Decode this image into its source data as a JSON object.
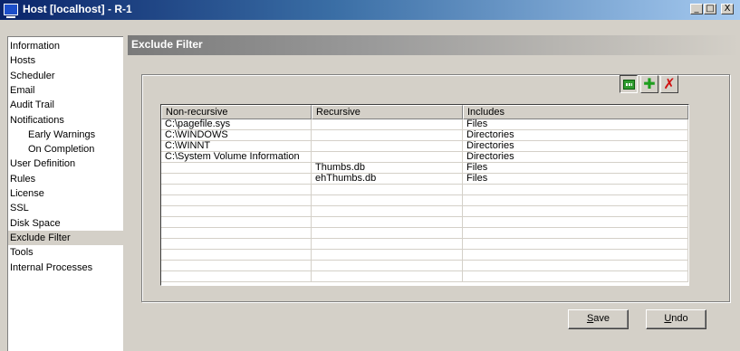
{
  "window": {
    "title": "Host [localhost] - R-1",
    "min_glyph": "_",
    "max_glyph": "□",
    "close_glyph": "X"
  },
  "sidebar": {
    "items": [
      {
        "label": "Information",
        "indent": false,
        "selected": false
      },
      {
        "label": "Hosts",
        "indent": false,
        "selected": false
      },
      {
        "label": "Scheduler",
        "indent": false,
        "selected": false
      },
      {
        "label": "Email",
        "indent": false,
        "selected": false
      },
      {
        "label": "Audit Trail",
        "indent": false,
        "selected": false
      },
      {
        "label": "Notifications",
        "indent": false,
        "selected": false
      },
      {
        "label": "Early Warnings",
        "indent": true,
        "selected": false
      },
      {
        "label": "On Completion",
        "indent": true,
        "selected": false
      },
      {
        "label": "User Definition",
        "indent": false,
        "selected": false
      },
      {
        "label": "Rules",
        "indent": false,
        "selected": false
      },
      {
        "label": "License",
        "indent": false,
        "selected": false
      },
      {
        "label": "SSL",
        "indent": false,
        "selected": false
      },
      {
        "label": "Disk Space",
        "indent": false,
        "selected": false
      },
      {
        "label": "Exclude Filter",
        "indent": false,
        "selected": true
      },
      {
        "label": "Tools",
        "indent": false,
        "selected": false
      },
      {
        "label": "Internal Processes",
        "indent": false,
        "selected": false
      }
    ]
  },
  "header": {
    "title": "Exclude Filter"
  },
  "toolbar": {
    "edit_icon": "edit-icon",
    "add_icon": "add-icon",
    "delete_icon": "delete-icon",
    "add_glyph": "✚",
    "delete_glyph": "✗"
  },
  "table": {
    "columns": [
      "Non-recursive",
      "Recursive",
      "Includes"
    ],
    "rows": [
      [
        "C:\\pagefile.sys",
        "",
        "Files"
      ],
      [
        "C:\\WINDOWS",
        "",
        "Directories"
      ],
      [
        "C:\\WINNT",
        "",
        "Directories"
      ],
      [
        "C:\\System Volume Information",
        "",
        "Directories"
      ],
      [
        "",
        "Thumbs.db",
        "Files"
      ],
      [
        "",
        "ehThumbs.db",
        "Files"
      ],
      [
        "",
        "",
        ""
      ],
      [
        "",
        "",
        ""
      ],
      [
        "",
        "",
        ""
      ],
      [
        "",
        "",
        ""
      ],
      [
        "",
        "",
        ""
      ],
      [
        "",
        "",
        ""
      ],
      [
        "",
        "",
        ""
      ],
      [
        "",
        "",
        ""
      ],
      [
        "",
        "",
        ""
      ]
    ]
  },
  "buttons": {
    "save_mnemonic": "S",
    "save_rest": "ave",
    "undo_mnemonic": "U",
    "undo_rest": "ndo"
  },
  "colors": {
    "titlebar_start": "#0a246a",
    "titlebar_end": "#a6caf0",
    "face": "#d4d0c8",
    "selected_item": "#d4d0c8"
  }
}
